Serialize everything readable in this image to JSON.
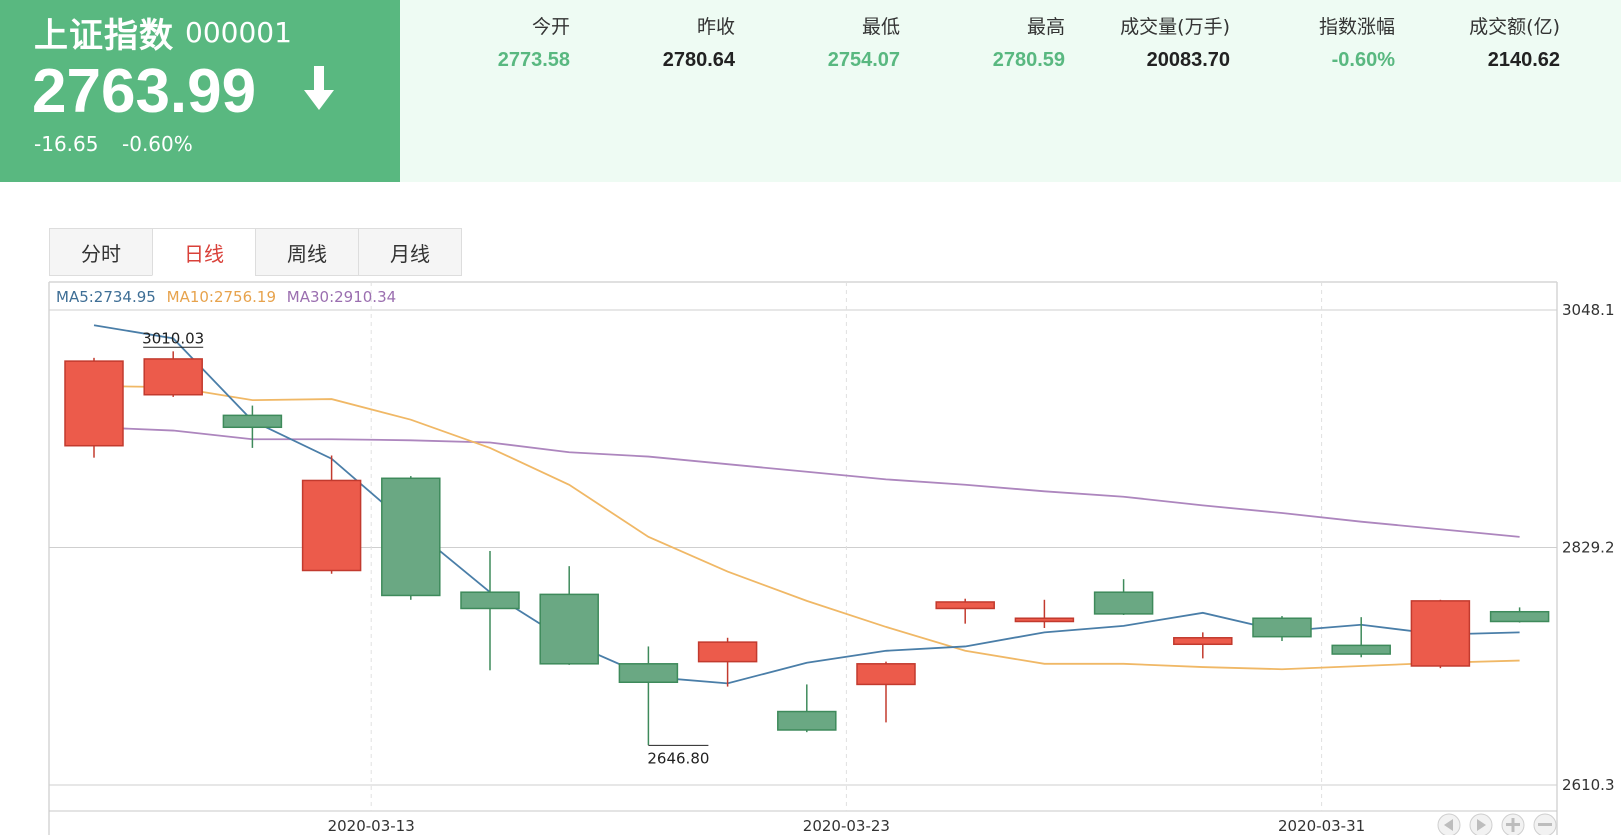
{
  "header": {
    "index_name": "上证指数",
    "index_code": "000001",
    "price": "2763.99",
    "change": "-16.65",
    "change_pct": "-0.60%",
    "direction_icon": "arrow-down-icon"
  },
  "stats": [
    {
      "label": "今开",
      "value": "2773.58",
      "color": "#59b880"
    },
    {
      "label": "昨收",
      "value": "2780.64",
      "color": "#222222"
    },
    {
      "label": "最低",
      "value": "2754.07",
      "color": "#59b880"
    },
    {
      "label": "最高",
      "value": "2780.59",
      "color": "#59b880"
    },
    {
      "label": "成交量(万手)",
      "value": "20083.70",
      "color": "#222222"
    },
    {
      "label": "指数涨幅",
      "value": "-0.60%",
      "color": "#59b880"
    },
    {
      "label": "成交额(亿)",
      "value": "2140.62",
      "color": "#222222"
    }
  ],
  "tabs": [
    {
      "label": "分时",
      "active": false
    },
    {
      "label": "日线",
      "active": true
    },
    {
      "label": "周线",
      "active": false
    },
    {
      "label": "月线",
      "active": false
    }
  ],
  "colors": {
    "panel_green": "#59b880",
    "candle_up": "#ec5b4b",
    "candle_down": "#6aa883",
    "ma5": "#4a7ea8",
    "ma10": "#f0b866",
    "ma30": "#ad86be"
  },
  "chart_data": {
    "type": "candlestick",
    "legend": [
      {
        "name": "MA5",
        "value": "2734.95",
        "color": "#3f6f96"
      },
      {
        "name": "MA10",
        "value": "2756.19",
        "color": "#e7a34d"
      },
      {
        "name": "MA30",
        "value": "2910.34",
        "color": "#9b6fb0"
      }
    ],
    "y_ticks": [
      "3048.1",
      "2829.2",
      "2610.3"
    ],
    "ylim": [
      2610.3,
      3048.1
    ],
    "x_ticks": [
      "2020-03-13",
      "2020-03-23",
      "2020-03-31"
    ],
    "x_tick_index": [
      3.5,
      9.5,
      15.5
    ],
    "high_label": "3010.03",
    "low_label": "2646.80",
    "candles": [
      {
        "o": 2923,
        "c": 3001,
        "h": 3004,
        "l": 2912
      },
      {
        "o": 2970,
        "c": 3003,
        "h": 3010,
        "l": 2968
      },
      {
        "o": 2951,
        "c": 2940,
        "h": 2960,
        "l": 2921
      },
      {
        "o": 2808,
        "c": 2891,
        "h": 2914,
        "l": 2805
      },
      {
        "o": 2893,
        "c": 2785,
        "h": 2895,
        "l": 2781
      },
      {
        "o": 2788,
        "c": 2773,
        "h": 2826,
        "l": 2716
      },
      {
        "o": 2786,
        "c": 2722,
        "h": 2812,
        "l": 2721
      },
      {
        "o": 2722,
        "c": 2705,
        "h": 2738,
        "l": 2647
      },
      {
        "o": 2724,
        "c": 2742,
        "h": 2746,
        "l": 2701
      },
      {
        "o": 2678,
        "c": 2661,
        "h": 2703,
        "l": 2659
      },
      {
        "o": 2703,
        "c": 2722,
        "h": 2724,
        "l": 2668
      },
      {
        "o": 2773,
        "c": 2779,
        "h": 2782,
        "l": 2759
      },
      {
        "o": 2761,
        "c": 2764,
        "h": 2781,
        "l": 2755
      },
      {
        "o": 2788,
        "c": 2768,
        "h": 2800,
        "l": 2767
      },
      {
        "o": 2740,
        "c": 2746,
        "h": 2751,
        "l": 2727
      },
      {
        "o": 2764,
        "c": 2747,
        "h": 2766,
        "l": 2743
      },
      {
        "o": 2739,
        "c": 2731,
        "h": 2765,
        "l": 2728
      },
      {
        "o": 2720,
        "c": 2780,
        "h": 2781,
        "l": 2718
      },
      {
        "o": 2770,
        "c": 2761,
        "h": 2774,
        "l": 2760
      }
    ],
    "ma5": [
      3034,
      3022,
      2946,
      2911,
      2848,
      2788,
      2742,
      2710,
      2704,
      2723,
      2734,
      2738,
      2751,
      2757,
      2769,
      2752,
      2758,
      2749,
      2751
    ],
    "ma10": [
      2978,
      2977,
      2965,
      2966,
      2947,
      2921,
      2887,
      2839,
      2807,
      2780,
      2756,
      2734,
      2722,
      2722,
      2719,
      2717,
      2720,
      2723,
      2725
    ],
    "ma30": [
      2940,
      2937,
      2929,
      2929,
      2928,
      2926,
      2917,
      2913,
      2906,
      2899,
      2892,
      2887,
      2881,
      2876,
      2868,
      2861,
      2853,
      2846,
      2839
    ]
  }
}
